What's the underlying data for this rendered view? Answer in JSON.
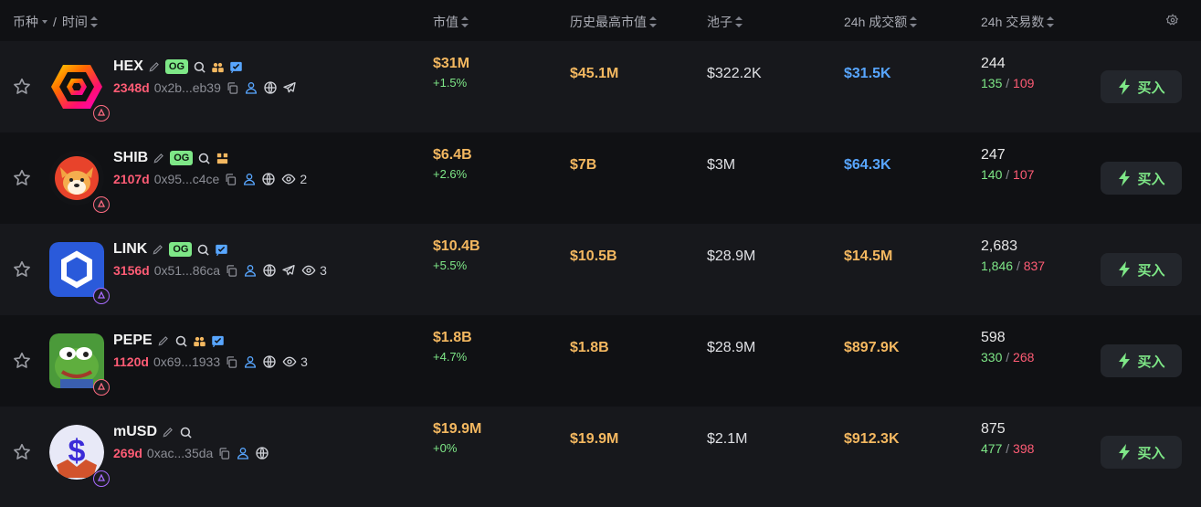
{
  "header": {
    "coin_label": "币种",
    "slash": "/",
    "time_label": "时间",
    "mcap_label": "市值",
    "ath_label": "历史最高市值",
    "pool_label": "池子",
    "vol_label": "24h 成交额",
    "txs_label": "24h 交易数"
  },
  "buy_label": "买入",
  "og_label": "OG",
  "slash": "/",
  "rows": [
    {
      "symbol": "HEX",
      "age": "2348d",
      "address": "0x2b...eb39",
      "mcap": "$31M",
      "change": "+1.5%",
      "ath": "$45.1M",
      "pool": "$322.2K",
      "volume": "$31.5K",
      "volume_color": "blue",
      "txs": "244",
      "buys": "135",
      "sells": "109",
      "views": ""
    },
    {
      "symbol": "SHIB",
      "age": "2107d",
      "address": "0x95...c4ce",
      "mcap": "$6.4B",
      "change": "+2.6%",
      "ath": "$7B",
      "pool": "$3M",
      "volume": "$64.3K",
      "volume_color": "blue",
      "txs": "247",
      "buys": "140",
      "sells": "107",
      "views": "2"
    },
    {
      "symbol": "LINK",
      "age": "3156d",
      "address": "0x51...86ca",
      "mcap": "$10.4B",
      "change": "+5.5%",
      "ath": "$10.5B",
      "pool": "$28.9M",
      "volume": "$14.5M",
      "volume_color": "orange",
      "txs": "2,683",
      "buys": "1,846",
      "sells": "837",
      "views": "3"
    },
    {
      "symbol": "PEPE",
      "age": "1120d",
      "address": "0x69...1933",
      "mcap": "$1.8B",
      "change": "+4.7%",
      "ath": "$1.8B",
      "pool": "$28.9M",
      "volume": "$897.9K",
      "volume_color": "orange",
      "txs": "598",
      "buys": "330",
      "sells": "268",
      "views": "3"
    },
    {
      "symbol": "mUSD",
      "age": "269d",
      "address": "0xac...35da",
      "mcap": "$19.9M",
      "change": "+0%",
      "ath": "$19.9M",
      "pool": "$2.1M",
      "volume": "$912.3K",
      "volume_color": "orange",
      "txs": "875",
      "buys": "477",
      "sells": "398",
      "views": ""
    }
  ],
  "colors": {
    "positive": "#7ee787",
    "negative": "#ff5c75",
    "value": "#f4b860",
    "blue": "#58a6ff",
    "bg": "#101114"
  }
}
